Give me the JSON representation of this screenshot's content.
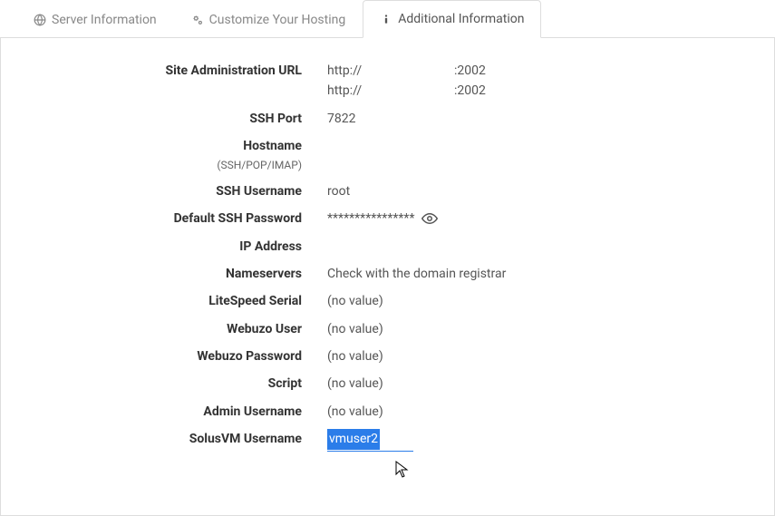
{
  "tabs": {
    "server_info": "Server Information",
    "customize": "Customize Your Hosting",
    "additional": "Additional Information"
  },
  "rows": {
    "site_admin_url": {
      "label": "Site Administration URL",
      "line1_prefix": "http://",
      "line1_port": ":2002",
      "line2_prefix": "http://",
      "line2_port": ":2002"
    },
    "ssh_port": {
      "label": "SSH Port",
      "value": "7822"
    },
    "hostname": {
      "label": "Hostname",
      "sub": "(SSH/POP/IMAP)",
      "value": ""
    },
    "ssh_username": {
      "label": "SSH Username",
      "value": "root"
    },
    "default_ssh_password": {
      "label": "Default SSH Password",
      "value": "****************"
    },
    "ip_address": {
      "label": "IP Address",
      "value": ""
    },
    "nameservers": {
      "label": "Nameservers",
      "value": "Check with the domain registrar"
    },
    "litespeed_serial": {
      "label": "LiteSpeed Serial",
      "value": "(no value)"
    },
    "webuzo_user": {
      "label": "Webuzo User",
      "value": "(no value)"
    },
    "webuzo_password": {
      "label": "Webuzo Password",
      "value": "(no value)"
    },
    "script": {
      "label": "Script",
      "value": "(no value)"
    },
    "admin_username": {
      "label": "Admin Username",
      "value": "(no value)"
    },
    "solusvm_username": {
      "label": "SolusVM Username",
      "value": "vmuser2"
    }
  }
}
